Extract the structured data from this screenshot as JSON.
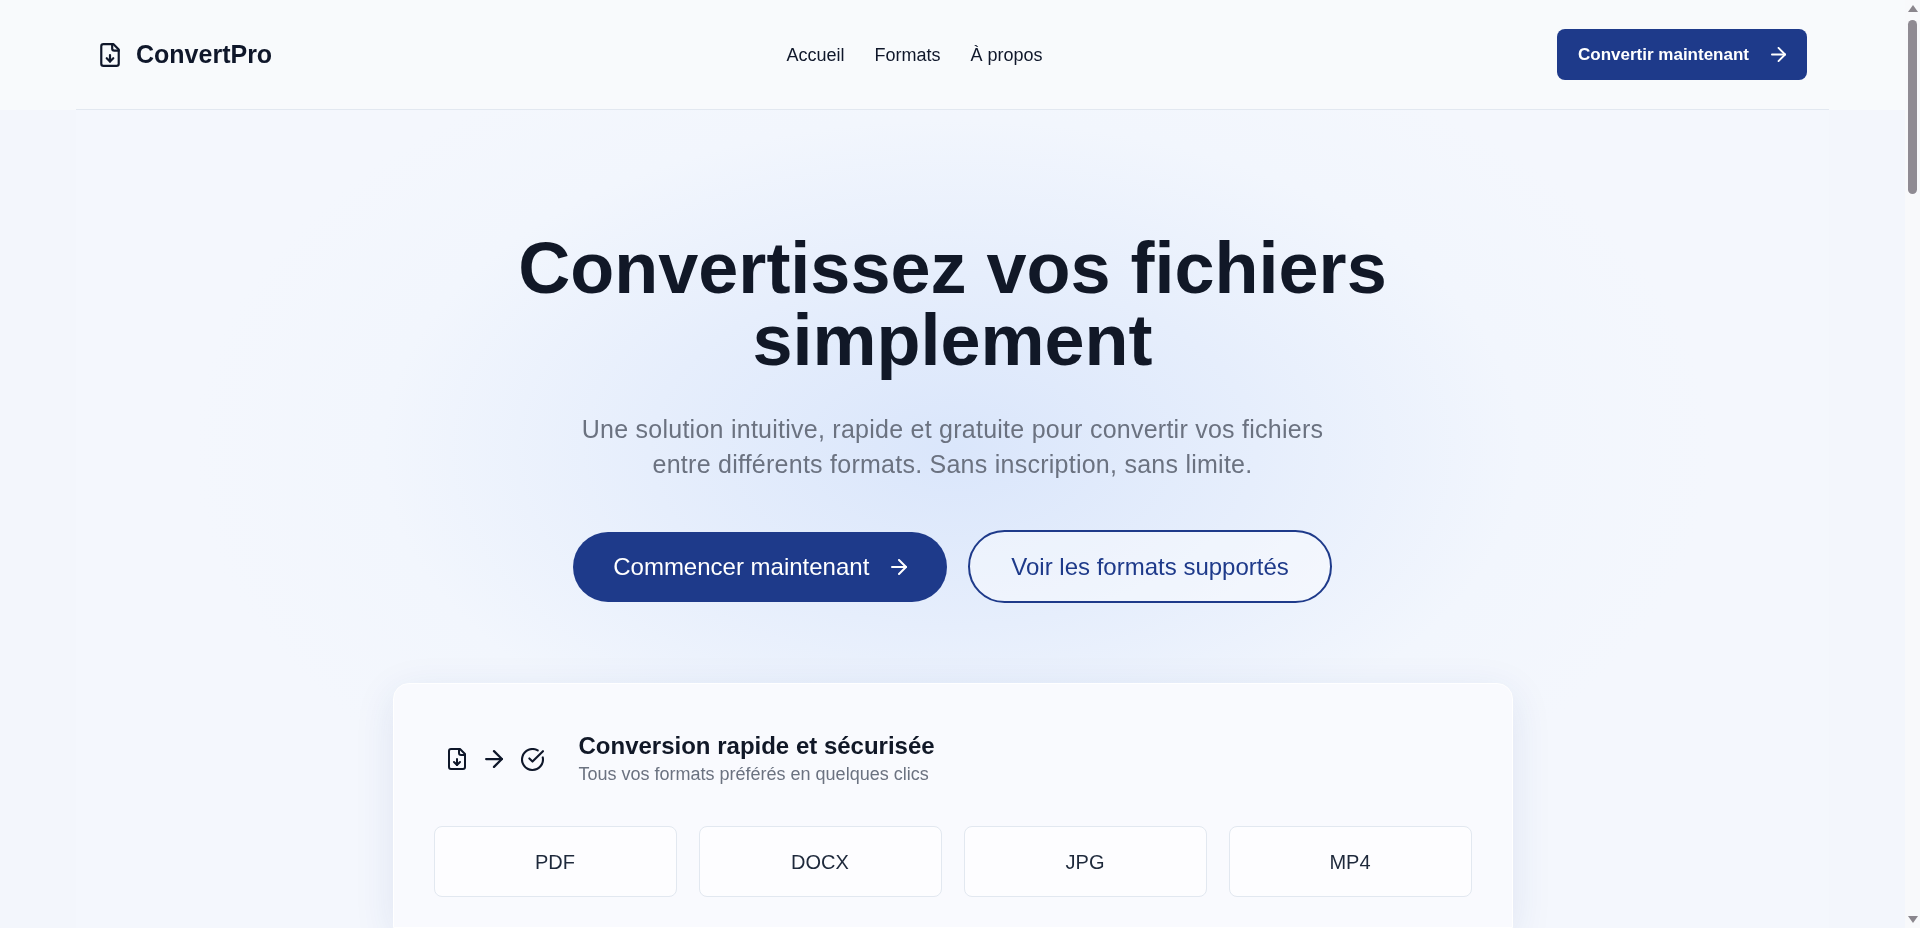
{
  "header": {
    "logo": "ConvertPro",
    "nav": [
      {
        "label": "Accueil"
      },
      {
        "label": "Formats"
      },
      {
        "label": "À propos"
      }
    ],
    "cta": "Convertir maintenant"
  },
  "hero": {
    "title": "Convertissez vos fichiers simplement",
    "subtitle": "Une solution intuitive, rapide et gratuite pour convertir vos fichiers entre différents formats. Sans inscription, sans limite.",
    "buttons": [
      {
        "label": "Commencer maintenant",
        "kind": "primary"
      },
      {
        "label": "Voir les formats supportés",
        "kind": "outline"
      }
    ]
  },
  "card": {
    "title": "Conversion rapide et sécurisée",
    "subtitle": "Tous vos formats préférés en quelques clics",
    "formats": [
      "PDF",
      "DOCX",
      "JPG",
      "MP4"
    ]
  }
}
